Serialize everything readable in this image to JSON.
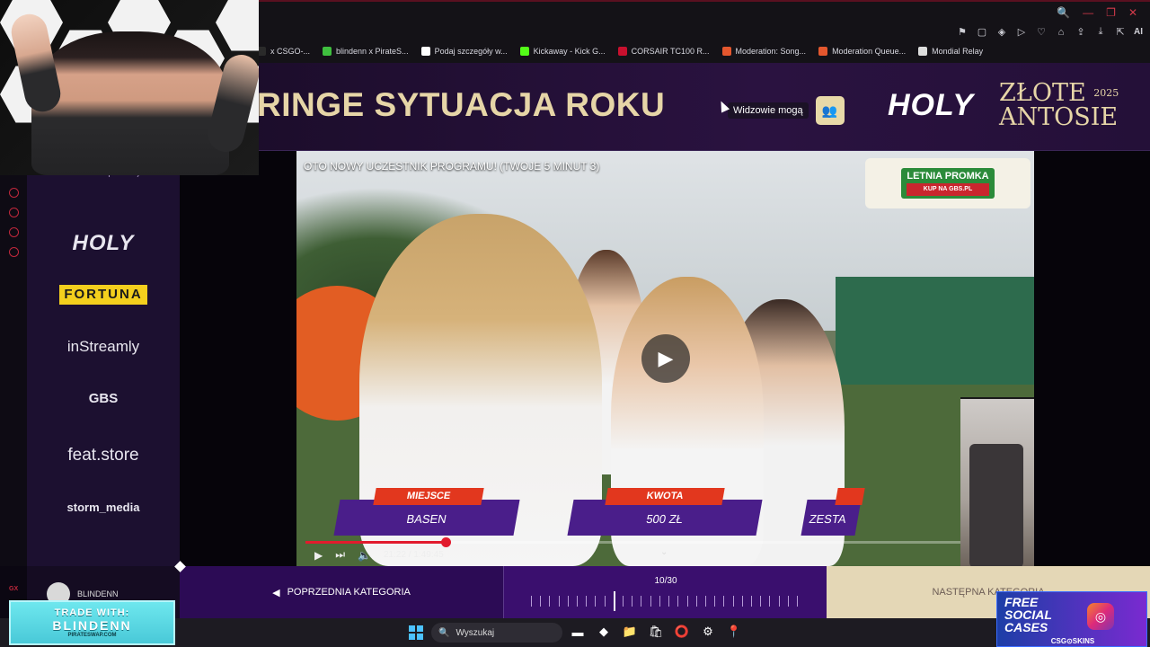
{
  "browser": {
    "window_controls": [
      "🔍",
      "—",
      "❐",
      "✕"
    ],
    "bookmarks": [
      {
        "label": "x CSGO-...",
        "color": "#2a2a2a"
      },
      {
        "label": "blindenn x PirateS...",
        "color": "#3fbf3f"
      },
      {
        "label": "Podaj szczegóły w...",
        "color": "#ffffff"
      },
      {
        "label": "Kickaway - Kick G...",
        "color": "#53fc18"
      },
      {
        "label": "CORSAIR TC100 R...",
        "color": "#c8102e"
      },
      {
        "label": "Moderation: Song...",
        "color": "#e4572e"
      },
      {
        "label": "Moderation Queue...",
        "color": "#e4572e"
      },
      {
        "label": "Mondial Relay",
        "color": "#dddddd"
      }
    ],
    "extensions": [
      "⚑",
      "▢",
      "◈",
      "▷",
      "♡",
      "⌂",
      "⇪",
      "⤓",
      "⇱"
    ],
    "ai_label": "AI"
  },
  "sidebar": {
    "partial_text": "sponsors)",
    "sponsors": [
      "HOLY",
      "FORTUNA",
      "inStreamly",
      "GBS",
      "feat.store",
      "storm_media"
    ],
    "footer_name": "BLINDENN",
    "rail_logo": "GX"
  },
  "header": {
    "category_title": "RINGE SYTUACJA ROKU",
    "viewers_label": "Widzowie mogą",
    "viewers_icon": "👥",
    "holy_logo": "HOLY",
    "awards_line1": "ZŁOTE",
    "awards_year": "2025",
    "awards_line2": "ANTOSIE"
  },
  "video": {
    "title": "OTO NOWY UCZESTNIK PROGRAMU! (TWOJE 5 MINUT 3)",
    "promo_title": "LETNIA PROMKA",
    "promo_sub": "KUP NA GBS.PL",
    "cards": [
      {
        "tag": "MIEJSCE",
        "value": "BASEN"
      },
      {
        "tag": "KWOTA",
        "value": "500 ZŁ"
      },
      {
        "tag": "",
        "value": "ZESTA"
      }
    ],
    "time": "21:22 / 1:49:45",
    "progress": 0.195,
    "play_glyph": "▶",
    "next_glyph": "⏭",
    "volume_glyph": "🔈",
    "chevron": "⌄"
  },
  "nav": {
    "prev_label": "POPRZEDNIA KATEGORIA",
    "prev_arrow": "◀",
    "counter": "10/30",
    "current": 10,
    "total": 30,
    "next_label": "NASTĘPNA KATEGORIA"
  },
  "overlays": {
    "trade_line1": "TRADE WITH:",
    "trade_line2": "BLINDENN",
    "trade_line3": "PIRATESWAP.COM",
    "csgo_free": "FREE",
    "csgo_social": "SOCIAL",
    "csgo_cases": "CASES",
    "csgo_brand": "CSG⊙SKINS"
  },
  "taskbar": {
    "search_placeholder": "Wyszukaj",
    "apps": [
      "▬",
      "◆",
      "📁",
      "🛍",
      "⭕",
      "⚙",
      "📍"
    ]
  },
  "colors": {
    "accent_gold": "#e6d5a7",
    "nav_purple": "#2c0b55",
    "progress_red": "#e21b2d"
  }
}
